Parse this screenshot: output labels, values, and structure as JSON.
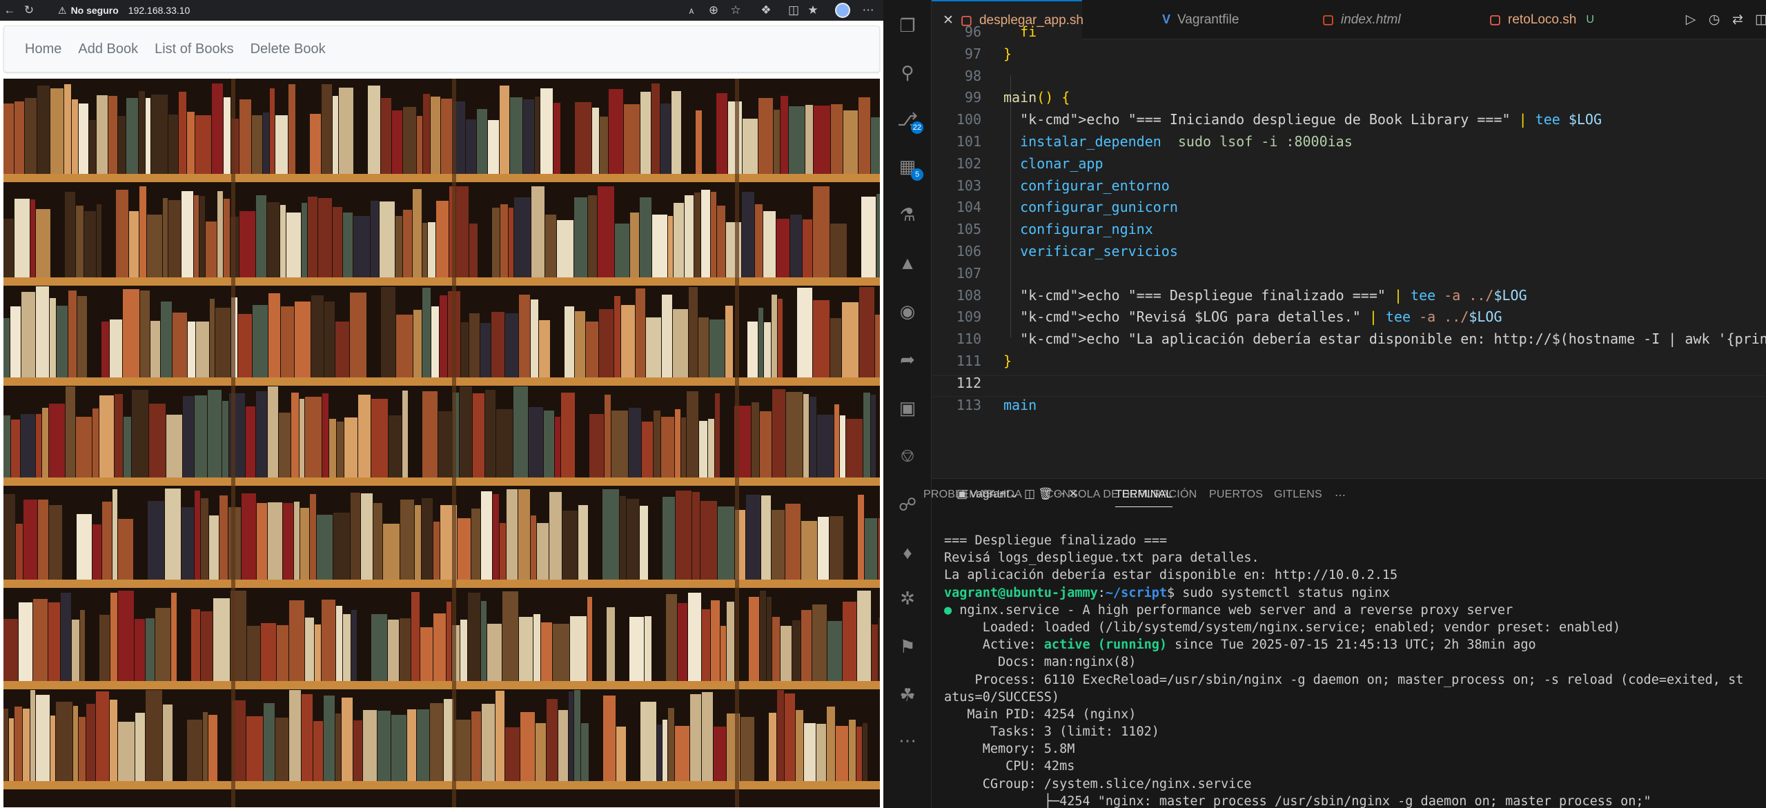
{
  "browser": {
    "security_label": "No seguro",
    "url": "192.168.33.10",
    "nav": [
      "Home",
      "Add Book",
      "List of Books",
      "Delete Book"
    ]
  },
  "vscode": {
    "tabs": [
      {
        "label": "desplegar_app.sh",
        "icon": "$",
        "active": true,
        "closable": true
      },
      {
        "label": "Vagrantfile",
        "icon": "V",
        "active": false
      },
      {
        "label": "index.html",
        "icon": "5",
        "active": false
      },
      {
        "label": "retoLoco.sh",
        "icon": "$",
        "active": false,
        "status": "U"
      }
    ],
    "activity_badges": {
      "source_control": "22",
      "extensions": "5"
    },
    "code": {
      "line_numbers": [
        "96",
        "97",
        "98",
        "99",
        "100",
        "101",
        "102",
        "103",
        "104",
        "105",
        "106",
        "107",
        "108",
        "109",
        "110",
        "111",
        "112",
        "113"
      ],
      "lines": [
        "  fi",
        "}",
        "",
        "main() {",
        "  echo \"=== Iniciando despliegue de Book Library ===\" | tee $LOG",
        "  instalar_dependen  sudo lsof -i :8000ias",
        "  clonar_app",
        "  configurar_entorno",
        "  configurar_gunicorn",
        "  configurar_nginx",
        "  verificar_servicios",
        "",
        "  echo \"=== Despliegue finalizado ===\" | tee -a ../$LOG",
        "  echo \"Revisá $LOG para detalles.\" | tee -a ../$LOG",
        "  echo \"La aplicación debería estar disponible en: http://$(hostname -I | awk '{print $",
        "}",
        "",
        "main"
      ]
    },
    "panel_tabs": [
      "PROBLEMAS",
      "SALIDA",
      "CONSOLA DE DEPURACIÓN",
      "TERMINAL",
      "PUERTOS",
      "GITLENS"
    ],
    "terminal_name": "vagrant",
    "terminal": {
      "l1": "=== Despliegue finalizado ===",
      "l2": "Revisá logs_despliegue.txt para detalles.",
      "l3": "La aplicación debería estar disponible en: http://10.0.2.15",
      "prompt_user": "vagrant@ubuntu-jammy",
      "prompt_path": "~/script",
      "command": "$ sudo systemctl status nginx",
      "service_title": " nginx.service - A high performance web server and a reverse proxy server",
      "loaded": "     Loaded: loaded (/lib/systemd/system/nginx.service; enabled; vendor preset: enabled)",
      "active_label": "     Active: ",
      "active_state": "active (running)",
      "active_rest": " since Tue 2025-07-15 21:45:13 UTC; 2h 38min ago",
      "docs": "       Docs: man:nginx(8)",
      "process1": "    Process: 6110 ExecReload=/usr/sbin/nginx -g daemon on; master_process on; -s reload (code=exited, st",
      "process2": "atus=0/SUCCESS)",
      "mainpid": "   Main PID: 4254 (nginx)",
      "tasks": "      Tasks: 3 (limit: 1102)",
      "memory": "     Memory: 5.8M",
      "cpu": "        CPU: 42ms",
      "cgroup": "     CGroup: /system.slice/nginx.service",
      "tree": "             ├─4254 \"nginx: master process /usr/sbin/nginx -g daemon on; master_process on;\""
    }
  }
}
